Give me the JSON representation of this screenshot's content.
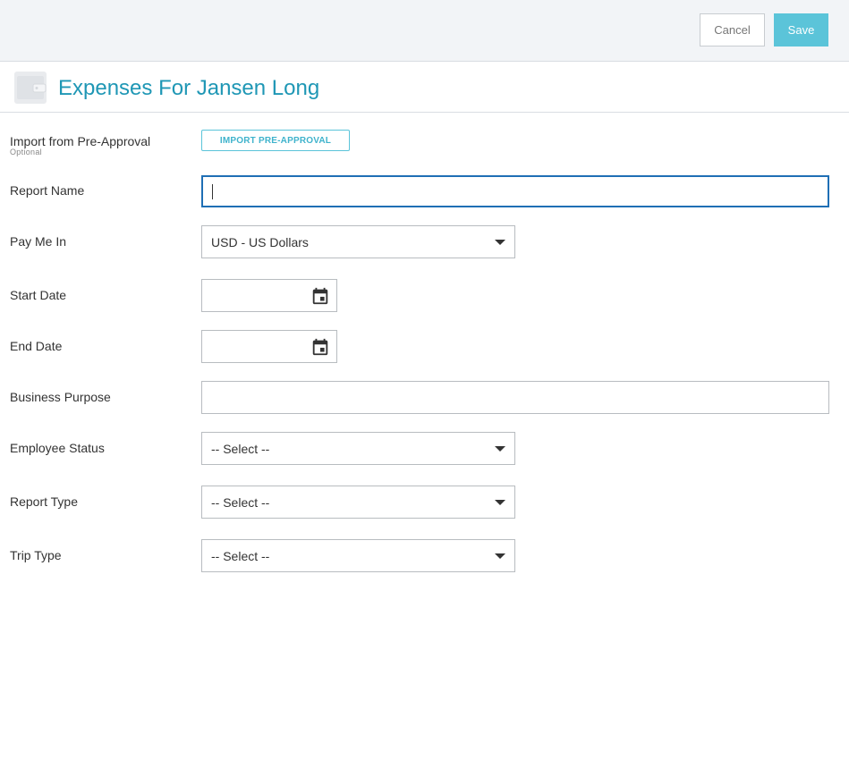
{
  "toolbar": {
    "cancel_label": "Cancel",
    "save_label": "Save"
  },
  "header": {
    "title": "Expenses For Jansen Long",
    "icon": "wallet-icon"
  },
  "form": {
    "import": {
      "label": "Import from Pre-Approval",
      "sublabel": "Optional",
      "button_label": "IMPORT PRE-APPROVAL"
    },
    "report_name": {
      "label": "Report Name",
      "value": ""
    },
    "pay_me_in": {
      "label": "Pay Me In",
      "value": "USD - US Dollars"
    },
    "start_date": {
      "label": "Start Date",
      "value": "",
      "icon": "calendar-icon"
    },
    "end_date": {
      "label": "End Date",
      "value": "",
      "icon": "calendar-icon"
    },
    "business_purpose": {
      "label": "Business Purpose",
      "value": ""
    },
    "employee_status": {
      "label": "Employee Status",
      "value": "-- Select --"
    },
    "report_type": {
      "label": "Report Type",
      "value": "-- Select --"
    },
    "trip_type": {
      "label": "Trip Type",
      "value": "-- Select --"
    }
  },
  "colors": {
    "accent": "#1f97b5",
    "save_button": "#5bc4d9",
    "focus_border": "#1f6fb5",
    "topbar_bg": "#f2f4f7"
  }
}
